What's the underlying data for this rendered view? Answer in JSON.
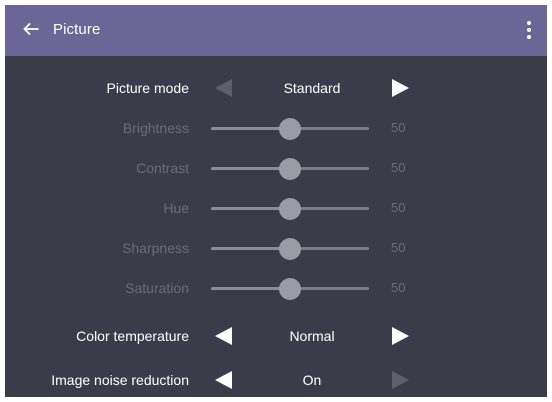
{
  "colors": {
    "header_bg": "#6b6696",
    "body_bg": "#3c3b4a",
    "text_primary": "#ffffff",
    "text_disabled": "#6b6a78",
    "arrow_enabled": "#ffffff",
    "arrow_disabled": "#5f5e6c",
    "slider_thumb": "#9b9ba5",
    "slider_track": "#7a7a88"
  },
  "header": {
    "title": "Picture",
    "back_icon": "arrow-left-icon",
    "menu_icon": "more-vertical-icon"
  },
  "settings": {
    "picture_mode": {
      "label": "Picture mode",
      "value": "Standard",
      "left_enabled": false,
      "right_enabled": true
    },
    "sliders": [
      {
        "label": "Brightness",
        "value": "50",
        "level": 0.5,
        "enabled": false
      },
      {
        "label": "Contrast",
        "value": "50",
        "level": 0.5,
        "enabled": false
      },
      {
        "label": "Hue",
        "value": "50",
        "level": 0.5,
        "enabled": false
      },
      {
        "label": "Sharpness",
        "value": "50",
        "level": 0.5,
        "enabled": false
      },
      {
        "label": "Saturation",
        "value": "50",
        "level": 0.5,
        "enabled": false
      }
    ],
    "color_temperature": {
      "label": "Color temperature",
      "value": "Normal",
      "left_enabled": true,
      "right_enabled": true
    },
    "image_noise_reduction": {
      "label": "Image noise reduction",
      "value": "On",
      "left_enabled": true,
      "right_enabled": false
    }
  }
}
